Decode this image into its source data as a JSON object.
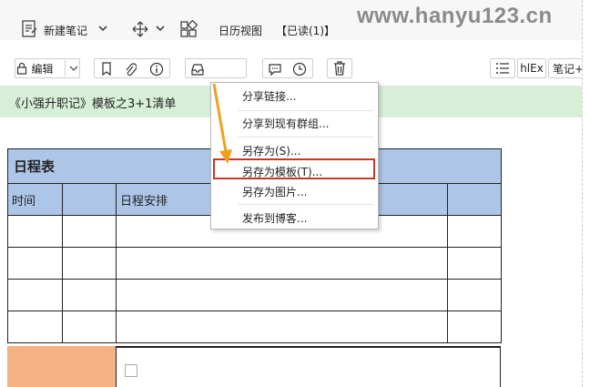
{
  "topbar": {
    "new_note": "新建笔记",
    "calendar_view": "日历视图",
    "read_status": "【已读(1)】"
  },
  "watermark": "www.hanyu123.cn",
  "toolbar": {
    "edit": "编辑",
    "font_tag": "hlEx",
    "notes_tag": "笔记+"
  },
  "note_title": "《小强升职记》模板之3+1清单",
  "share_menu": {
    "items": [
      "分享链接...",
      "分享到现有群组...",
      "另存为(S)...",
      "另存为模板(T)...",
      "另存为图片...",
      "发布到博客..."
    ]
  },
  "schedule": {
    "title": "日程表",
    "col_time": "时间",
    "col_plan": "日程安排"
  },
  "colors": {
    "title_green": "#d7efd7",
    "table_header_blue": "#adc5e7",
    "highlight_red": "#c0392b",
    "arrow_orange": "#f0a020",
    "cell_orange": "#f4b183"
  }
}
